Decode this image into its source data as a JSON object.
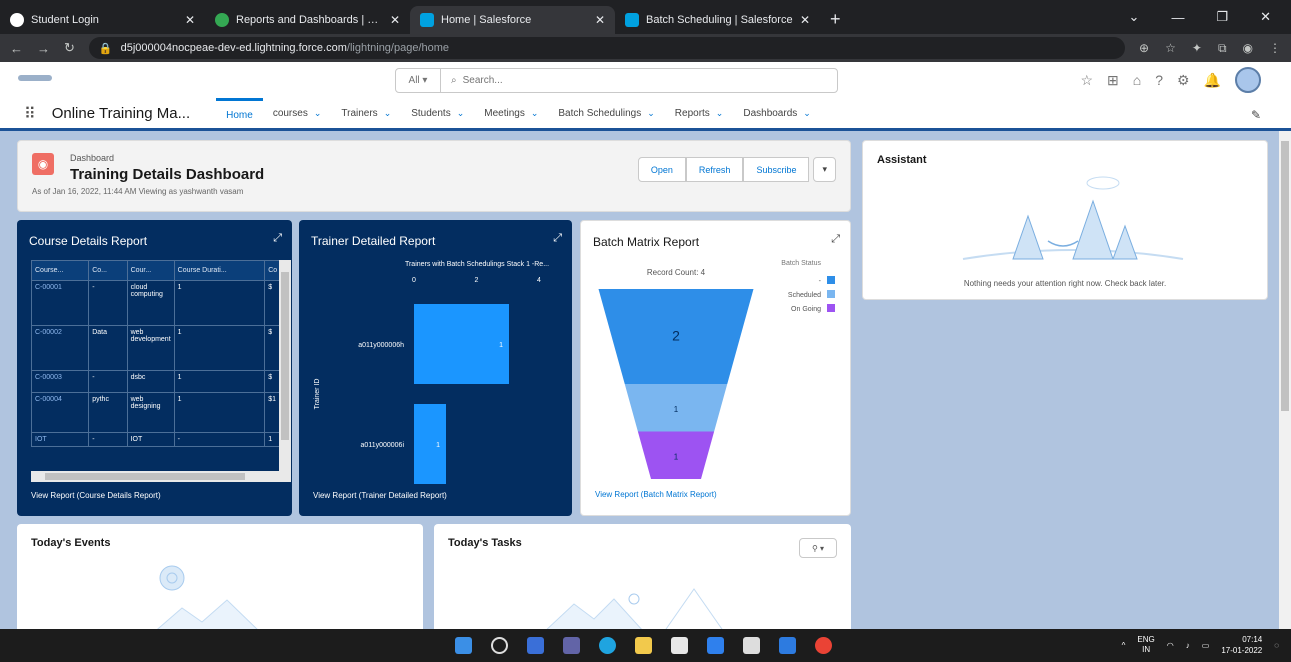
{
  "browser": {
    "tabs": [
      {
        "title": "Student Login",
        "color": "#ffffff",
        "active": false
      },
      {
        "title": "Reports and Dashboards | Smar",
        "color": "#34a853",
        "active": false
      },
      {
        "title": "Home | Salesforce",
        "color": "#00a1e0",
        "active": true
      },
      {
        "title": "Batch Scheduling | Salesforce",
        "color": "#00a1e0",
        "active": false
      }
    ],
    "new_tab": "+",
    "url_host": "d5j000004nocpeae-dev-ed.lightning.force.com",
    "url_path": "/lightning/page/home"
  },
  "sf": {
    "scope": "All",
    "search_placeholder": "Search...",
    "app_name": "Online Training Ma...",
    "nav": [
      {
        "label": "Home",
        "active": true,
        "dropdown": false
      },
      {
        "label": "courses",
        "active": false,
        "dropdown": true
      },
      {
        "label": "Trainers",
        "active": false,
        "dropdown": true
      },
      {
        "label": "Students",
        "active": false,
        "dropdown": true
      },
      {
        "label": "Meetings",
        "active": false,
        "dropdown": true
      },
      {
        "label": "Batch Schedulings",
        "active": false,
        "dropdown": true
      },
      {
        "label": "Reports",
        "active": false,
        "dropdown": true
      },
      {
        "label": "Dashboards",
        "active": false,
        "dropdown": true
      }
    ]
  },
  "dashboard": {
    "type_label": "Dashboard",
    "title": "Training Details Dashboard",
    "subtitle": "As of Jan 16, 2022, 11:44 AM Viewing as yashwanth vasam",
    "buttons": {
      "open": "Open",
      "refresh": "Refresh",
      "subscribe": "Subscribe"
    }
  },
  "course_report": {
    "title": "Course Details Report",
    "columns": [
      "Course...",
      "Co...",
      "Cour...",
      "Course Durati...",
      "Co"
    ],
    "rows": [
      {
        "id": "C-00001",
        "c2": "-",
        "name": "cloud computing",
        "dur": "1",
        "c5": "$"
      },
      {
        "id": "C-00002",
        "c2": "Data",
        "name": "web development",
        "dur": "1",
        "c5": "$"
      },
      {
        "id": "C-00003",
        "c2": "-",
        "name": "dsbc",
        "dur": "1",
        "c5": "$"
      },
      {
        "id": "C-00004",
        "c2": "pythc",
        "name": "web designing",
        "dur": "1",
        "c5": "$1"
      },
      {
        "id": "IOT",
        "c2": "-",
        "name": "IOT",
        "dur": "-",
        "c5": "1"
      }
    ],
    "footer": "View Report (Course Details Report)"
  },
  "trainer_report": {
    "title": "Trainer Detailed Report",
    "footer": "View Report (Trainer Detailed Report)",
    "chart_data": {
      "type": "bar",
      "orientation": "horizontal",
      "title": "Trainers with Batch Schedulings Stack 1 -Re...",
      "ylabel": "Trainer ID",
      "categories": [
        "a011y000006h",
        "a011y000006i"
      ],
      "values": [
        1,
        1
      ],
      "xlim": [
        0,
        4
      ],
      "ticks": [
        "0",
        "2",
        "4"
      ]
    }
  },
  "batch_report": {
    "title": "Batch Matrix Report",
    "footer": "View Report (Batch Matrix Report)",
    "chart_data": {
      "type": "funnel",
      "title": "Record Count: 4",
      "legend_title": "Batch Status",
      "legend_position": "right",
      "series": [
        {
          "name": "-",
          "value": 2,
          "color": "#2e8ee8"
        },
        {
          "name": "Scheduled",
          "value": 1,
          "color": "#7ab6f0"
        },
        {
          "name": "On Going",
          "value": 1,
          "color": "#9d53f2"
        }
      ]
    }
  },
  "assistant": {
    "title": "Assistant",
    "message": "Nothing needs your attention right now. Check back later."
  },
  "events": {
    "title": "Today's Events"
  },
  "tasks": {
    "title": "Today's Tasks"
  },
  "taskbar": {
    "lang": "ENG",
    "region": "IN",
    "time": "07:14",
    "date": "17-01-2022"
  }
}
